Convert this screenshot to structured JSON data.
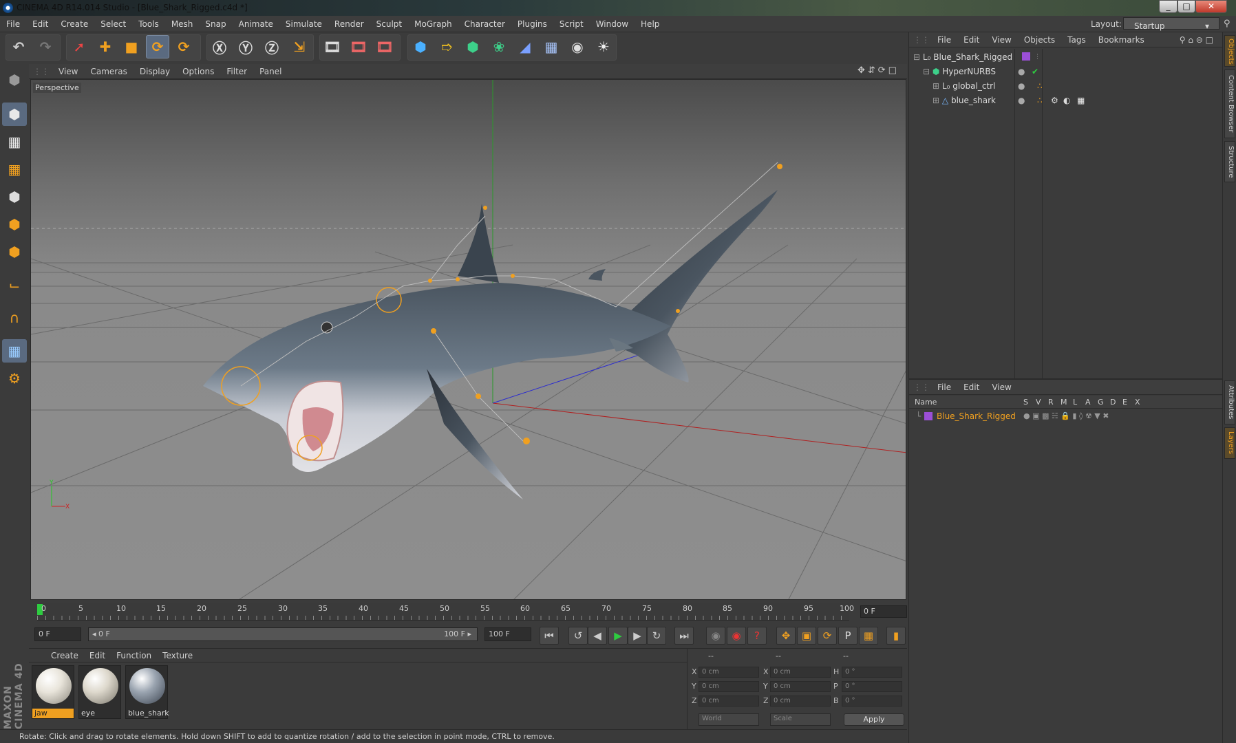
{
  "window": {
    "title": "CINEMA 4D R14.014 Studio - [Blue_Shark_Rigged.c4d *]",
    "minimize": "_",
    "maximize": "□",
    "close": "✕"
  },
  "menu": [
    "File",
    "Edit",
    "Create",
    "Select",
    "Tools",
    "Mesh",
    "Snap",
    "Animate",
    "Simulate",
    "Render",
    "Sculpt",
    "MoGraph",
    "Character",
    "Plugins",
    "Script",
    "Window",
    "Help"
  ],
  "layout": {
    "label": "Layout:",
    "value": "Startup"
  },
  "viewport": {
    "menu": [
      "View",
      "Cameras",
      "Display",
      "Options",
      "Filter",
      "Panel"
    ],
    "label": "Perspective"
  },
  "timeline": {
    "ticks": [
      "0",
      "5",
      "10",
      "15",
      "20",
      "25",
      "30",
      "35",
      "40",
      "45",
      "50",
      "55",
      "60",
      "65",
      "70",
      "75",
      "80",
      "85",
      "90",
      "95",
      "100"
    ],
    "current_frame": "0 F"
  },
  "transport": {
    "start": "0 F",
    "range_start": "◂ 0 F",
    "range_end": "100 F ▸",
    "end": "100 F"
  },
  "material_manager": {
    "menu": [
      "Create",
      "Edit",
      "Function",
      "Texture"
    ],
    "materials": [
      {
        "name": "jaw",
        "selected": true
      },
      {
        "name": "eye",
        "selected": false
      },
      {
        "name": "blue_shark",
        "selected": false
      }
    ]
  },
  "coordinates": {
    "headers": [
      "--",
      "--",
      "--"
    ],
    "rows": [
      {
        "a": "X",
        "a_val": "0 cm",
        "b": "X",
        "b_val": "0 cm",
        "c": "H",
        "c_val": "0 °"
      },
      {
        "a": "Y",
        "a_val": "0 cm",
        "b": "Y",
        "b_val": "0 cm",
        "c": "P",
        "c_val": "0 °"
      },
      {
        "a": "Z",
        "a_val": "0 cm",
        "b": "Z",
        "b_val": "0 cm",
        "c": "B",
        "c_val": "0 °"
      }
    ],
    "mode": "World",
    "transform": "Scale",
    "apply": "Apply"
  },
  "status": "Rotate: Click and drag to rotate elements. Hold down SHIFT to add to quantize rotation / add to the selection in point mode, CTRL to remove.",
  "objects_panel": {
    "menu": [
      "File",
      "Edit",
      "View",
      "Objects",
      "Tags",
      "Bookmarks"
    ],
    "items": [
      {
        "name": "Blue_Shark_Rigged",
        "depth": 0
      },
      {
        "name": "HyperNURBS",
        "depth": 1
      },
      {
        "name": "global_ctrl",
        "depth": 2
      },
      {
        "name": "blue_shark",
        "depth": 2
      }
    ]
  },
  "layers_panel": {
    "menu": [
      "File",
      "Edit",
      "View"
    ],
    "columns": [
      "Name",
      "S",
      "V",
      "R",
      "M",
      "L",
      "A",
      "G",
      "D",
      "E",
      "X"
    ],
    "layer_name": "Blue_Shark_Rigged",
    "layer_color": "#9b4fd6"
  },
  "side_tabs": [
    "Objects",
    "Content Browser",
    "Structure",
    "Attributes",
    "Layers"
  ],
  "brand": "MAXON CINEMA 4D",
  "colors": {
    "accent": "#f0a020",
    "select": "#5a6a80"
  }
}
